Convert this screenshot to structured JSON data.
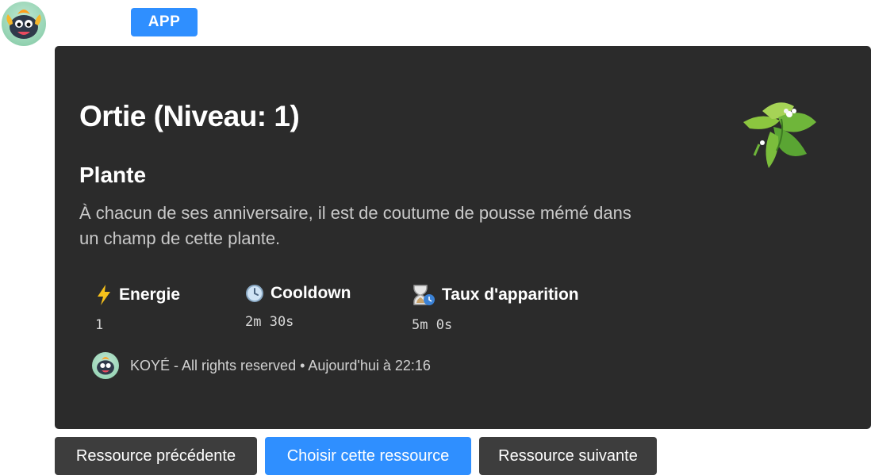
{
  "header": {
    "badge_label": "APP"
  },
  "embed": {
    "title": "Ortie (Niveau: 1)",
    "type_label": "Plante",
    "description": "À chacun de ses anniversaire, il est de coutume de pousse mémé dans un champ de cette plante.",
    "fields": [
      {
        "icon": "lightning-icon",
        "name": "Energie",
        "value": "1"
      },
      {
        "icon": "clock-icon",
        "name": "Cooldown",
        "value": "2m 30s"
      },
      {
        "icon": "hourglass-icon",
        "name": "Taux d'apparition",
        "value": "5m 0s"
      }
    ],
    "footer_text": "KOYÉ - All rights reserved • Aujourd'hui à 22:16",
    "thumbnail": "nettle-plant-icon"
  },
  "buttons": {
    "previous": "Ressource précédente",
    "choose": "Choisir cette ressource",
    "next": "Ressource suivante"
  },
  "colors": {
    "accent": "#2f8fff",
    "embed_bg": "#2b2b2b",
    "button_secondary": "#3d3d3d"
  }
}
